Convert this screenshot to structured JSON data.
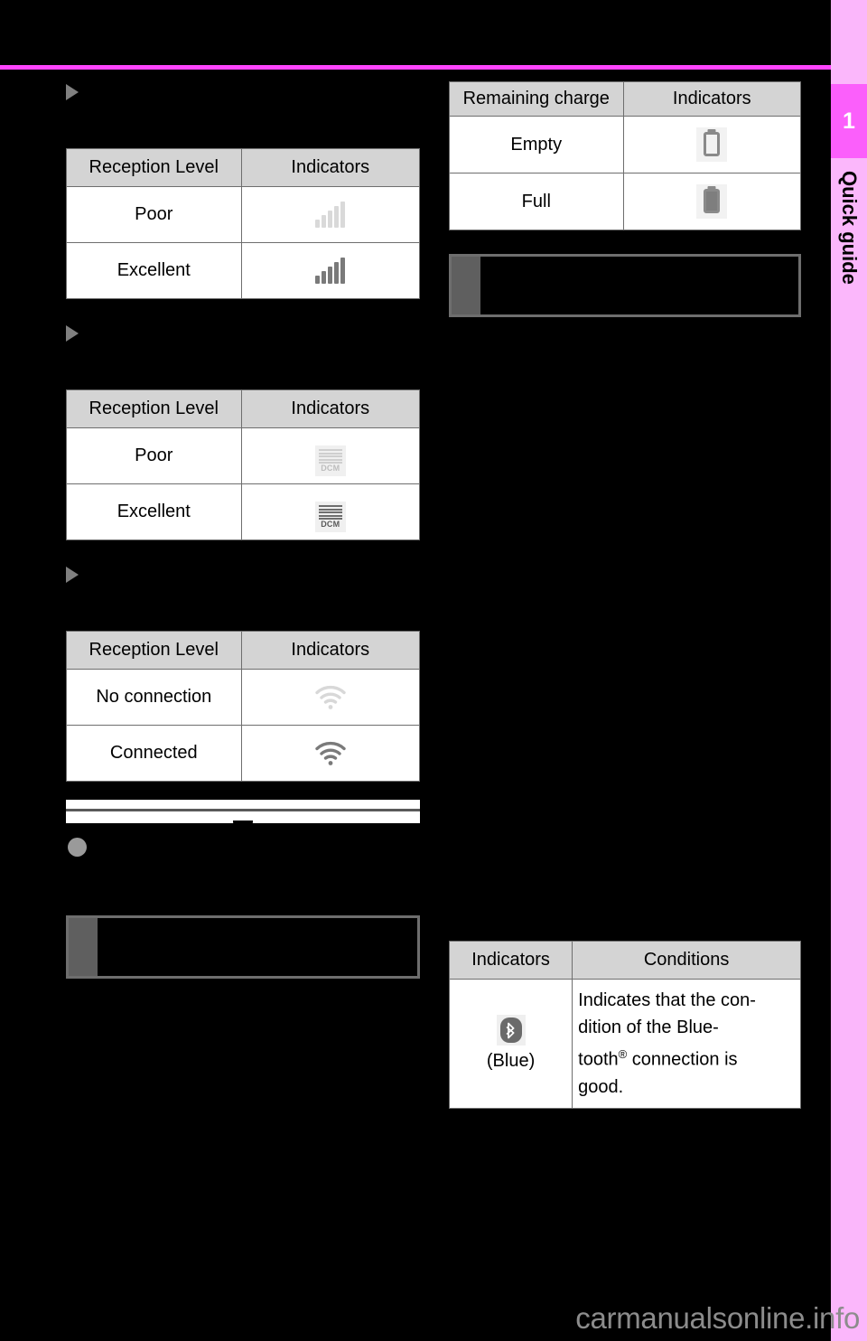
{
  "sidebar": {
    "chapter_number": "1",
    "chapter_label": "Quick guide"
  },
  "left_column": {
    "cellular_table": {
      "headers": [
        "Reception Level",
        "Indicators"
      ],
      "rows": [
        {
          "level": "Poor",
          "icon": "signal-bars-poor-icon"
        },
        {
          "level": "Excellent",
          "icon": "signal-bars-excellent-icon"
        }
      ]
    },
    "dcm_table": {
      "headers": [
        "Reception Level",
        "Indicators"
      ],
      "rows": [
        {
          "level": "Poor",
          "icon": "dcm-poor-icon",
          "icon_label": "DCM"
        },
        {
          "level": "Excellent",
          "icon": "dcm-excellent-icon",
          "icon_label": "DCM"
        }
      ]
    },
    "wifi_table": {
      "headers": [
        "Reception Level",
        "Indicators"
      ],
      "rows": [
        {
          "level": "No connection",
          "icon": "wifi-no-connection-icon"
        },
        {
          "level": "Connected",
          "icon": "wifi-connected-icon"
        }
      ]
    }
  },
  "right_column": {
    "battery_table": {
      "headers": [
        "Remaining charge",
        "Indicators"
      ],
      "rows": [
        {
          "level": "Empty",
          "icon": "battery-empty-icon"
        },
        {
          "level": "Full",
          "icon": "battery-full-icon"
        }
      ]
    },
    "bluetooth_table": {
      "headers": [
        "Indicators",
        "Conditions"
      ],
      "rows": [
        {
          "icon": "bluetooth-icon",
          "icon_caption": "(Blue)",
          "condition_text_1": "Indicates that the con-",
          "condition_text_2": "dition of the Blue-",
          "condition_text_3a": "tooth",
          "condition_text_3sup": "®",
          "condition_text_3b": " connection is",
          "condition_text_4": "good."
        }
      ]
    }
  },
  "footer": {
    "watermark_main": "carmanualsonline",
    "watermark_tld": ".info"
  },
  "colors": {
    "accent_magenta": "#ff44ff",
    "tab_pink": "#fbb7fb",
    "badge_pink": "#fb5ffb",
    "table_header_gray": "#d4d4d4",
    "border_gray": "#6e6e6e",
    "page_background": "#000000"
  }
}
